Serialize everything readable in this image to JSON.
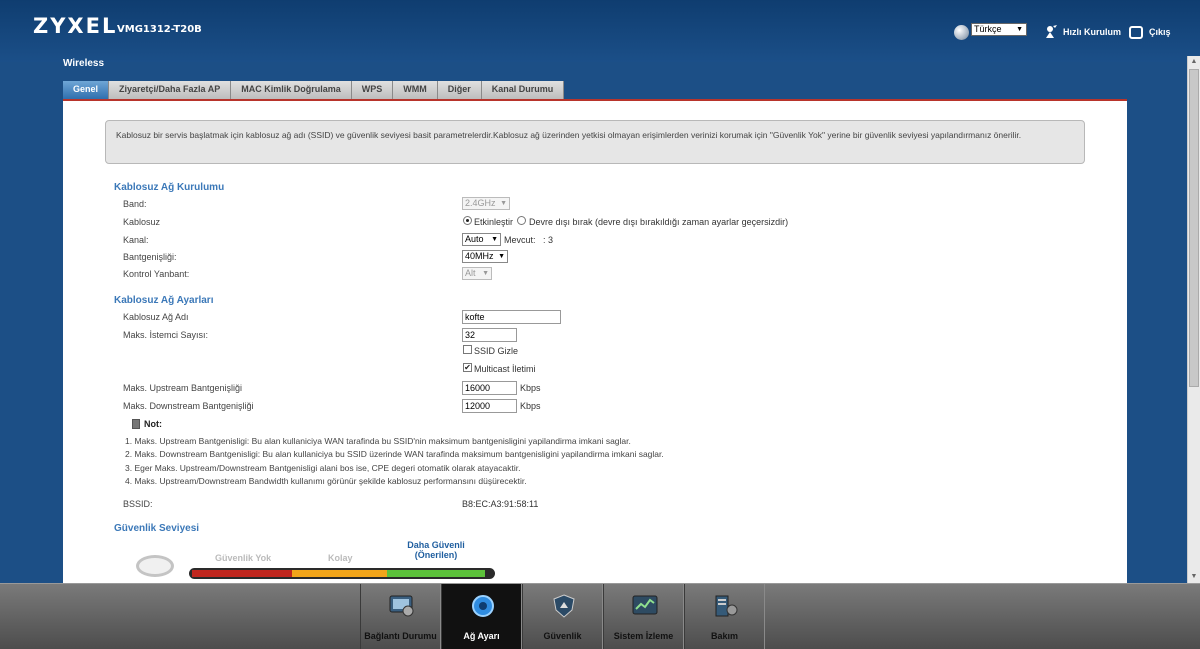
{
  "header": {
    "brand": "ZYXEL",
    "model": "VMG1312-T20B",
    "language": "Türkçe",
    "quick_setup": "Hızlı Kurulum",
    "logout": "Çıkış"
  },
  "page_title": "Wireless",
  "tabs": [
    {
      "label": "Genel",
      "active": true
    },
    {
      "label": "Ziyaretçi/Daha Fazla AP"
    },
    {
      "label": "MAC Kimlik Doğrulama"
    },
    {
      "label": "WPS"
    },
    {
      "label": "WMM"
    },
    {
      "label": "Diğer"
    },
    {
      "label": "Kanal Durumu"
    }
  ],
  "notice": "Kablosuz bir servis başlatmak için kablosuz ağ adı (SSID) ve güvenlik seviyesi basit parametrelerdir.Kablosuz ağ üzerinden yetkisi olmayan erişimlerden verinizi korumak için \"Güvenlik Yok\" yerine bir güvenlik seviyesi yapılandırmanız önerilir.",
  "setup": {
    "title": "Kablosuz Ağ Kurulumu",
    "band_label": "Band:",
    "band_value": "2.4GHz",
    "wireless_label": "Kablosuz",
    "enable_label": "Etkinleştir",
    "disable_label": "Devre dışı bırak (devre dışı bırakıldığı zaman ayarlar geçersizdir)",
    "channel_label": "Kanal:",
    "channel_value": "Auto",
    "current_label": "Mevcut:",
    "current_value": ": 3",
    "bandwidth_label": "Bantgenişliği:",
    "bandwidth_value": "40MHz",
    "sideband_label": "Kontrol Yanbant:",
    "sideband_value": "Alt"
  },
  "settings": {
    "title": "Kablosuz Ağ Ayarları",
    "ssid_label": "Kablosuz Ağ Adı",
    "ssid_value": "kofte",
    "max_clients_label": "Maks. İstemci Sayısı:",
    "max_clients_value": "32",
    "hide_ssid_label": "SSID Gizle",
    "hide_ssid_checked": false,
    "multicast_label": "Multicast İletimi",
    "multicast_checked": true,
    "upstream_label": "Maks. Upstream Bantgenişliği",
    "upstream_value": "16000",
    "upstream_unit": "Kbps",
    "downstream_label": "Maks. Downstream Bantgenişliği",
    "downstream_value": "12000",
    "downstream_unit": "Kbps"
  },
  "note": {
    "title": "Not:",
    "items": [
      "1. Maks. Upstream Bantgenisligi: Bu alan kullaniciya WAN tarafinda bu SSID'nin maksimum bantgenisligini yapilandirma imkani saglar.",
      "2. Maks. Downstream Bantgenisligi: Bu alan kullaniciya bu SSID üzerinde WAN tarafinda maksimum bantgenisligini yapilandirma imkani saglar.",
      "3. Eger Maks. Upstream/Downstream Bantgenisligi alani bos ise, CPE degeri otomatik olarak atayacaktir.",
      "4. Maks. Upstream/Downstream Bandwidth kullanımı görünür şekilde kablosuz performansını düşürecektir."
    ]
  },
  "bssid": {
    "label": "BSSID:",
    "value": "B8:EC:A3:91:58:11"
  },
  "security": {
    "title": "Güvenlik Seviyesi",
    "levels": [
      "Güvenlik Yok",
      "Kolay",
      "Daha Güvenli",
      "(Önerilen)"
    ],
    "colors": {
      "red": "#c0261e",
      "orange": "#f2a51a",
      "green": "#5cc13a"
    }
  },
  "dock": [
    {
      "label": "Bağlantı Durumu",
      "icon": "connection-status-icon"
    },
    {
      "label": "Ağ Ayarı",
      "icon": "network-setting-icon",
      "active": true
    },
    {
      "label": "Güvenlik",
      "icon": "security-shield-icon"
    },
    {
      "label": "Sistem İzleme",
      "icon": "system-monitor-icon"
    },
    {
      "label": "Bakım",
      "icon": "maintenance-icon"
    }
  ]
}
